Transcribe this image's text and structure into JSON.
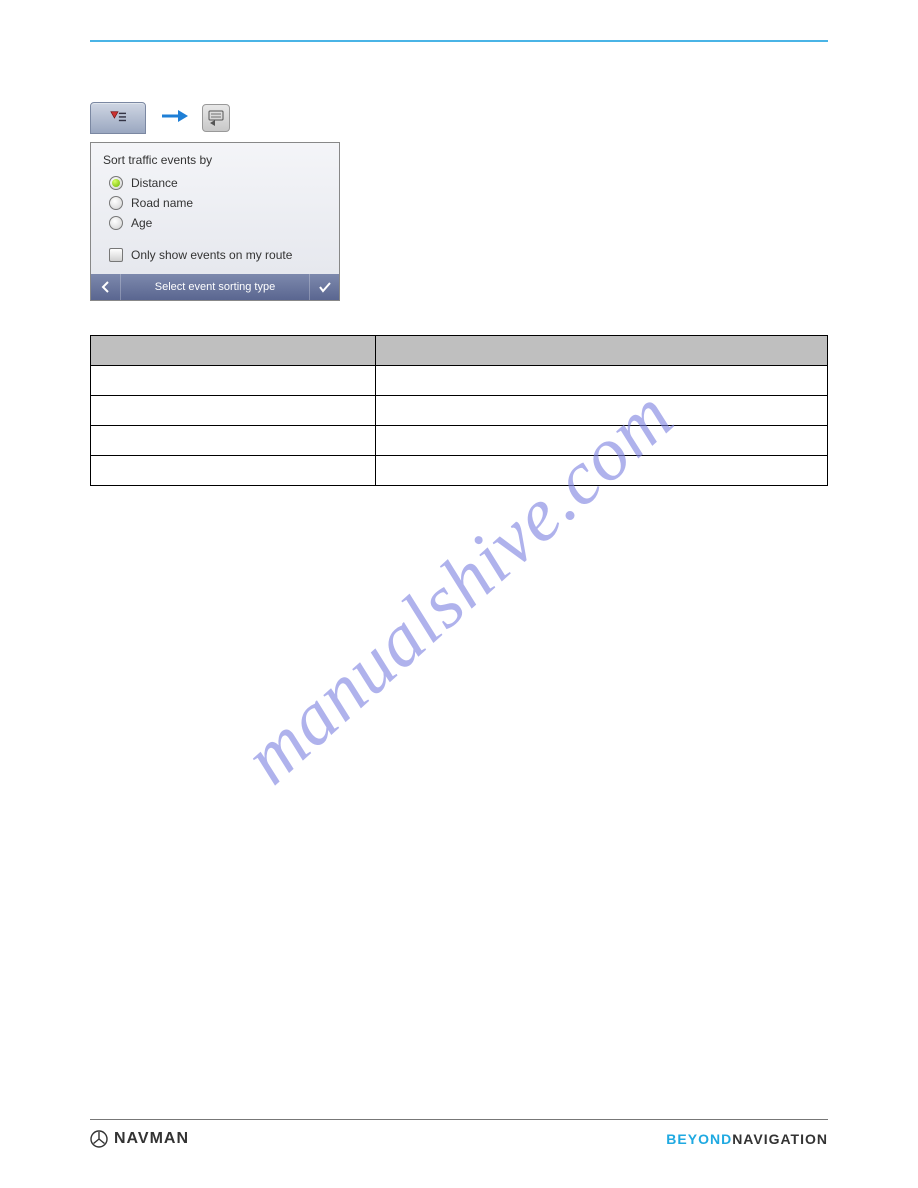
{
  "watermark": "manualshive.com",
  "panel": {
    "title": "Sort traffic events by",
    "options": [
      "Distance",
      "Road name",
      "Age"
    ],
    "selected_index": 0,
    "checkbox_label": "Only show events on my route",
    "footer_label": "Select event sorting type"
  },
  "table": {
    "headers": [
      "",
      ""
    ],
    "rows": [
      [
        "",
        ""
      ],
      [
        "",
        ""
      ],
      [
        "",
        ""
      ],
      [
        "",
        ""
      ]
    ]
  },
  "footer": {
    "logo_text": "NAVMAN",
    "brand_left": "BEYOND",
    "brand_right": "NAVIGATION"
  }
}
